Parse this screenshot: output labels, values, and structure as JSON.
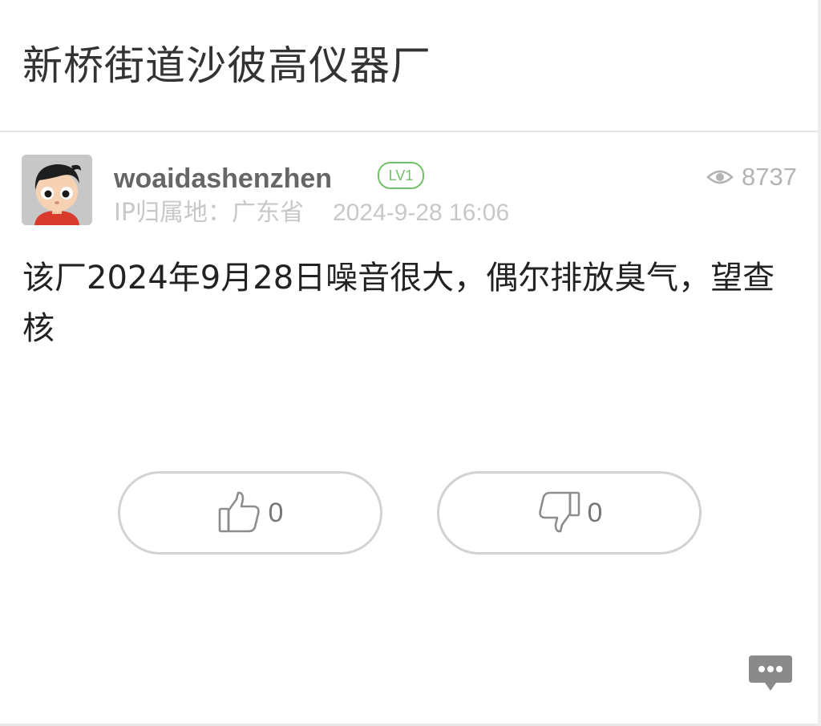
{
  "header": {
    "title": "新桥街道沙彼高仪器厂"
  },
  "post": {
    "author": {
      "username": "woaidashenzhen",
      "level": "LV1",
      "avatar_icon": "cartoon-boy-avatar"
    },
    "views": "8737",
    "ip_location": "IP归属地：广东省",
    "timestamp": "2024-9-28 16:06",
    "content": "该厂2024年9月28日噪音很大，偶尔排放臭气，望查核"
  },
  "actions": {
    "like_count": "0",
    "dislike_count": "0",
    "like_icon": "thumbs-up-icon",
    "dislike_icon": "thumbs-down-icon",
    "comment_icon": "comment-bubble-icon"
  },
  "colors": {
    "badge_green": "#72c067",
    "muted_gray": "#c8c8c8",
    "fab_gray": "#8a8a8a"
  }
}
